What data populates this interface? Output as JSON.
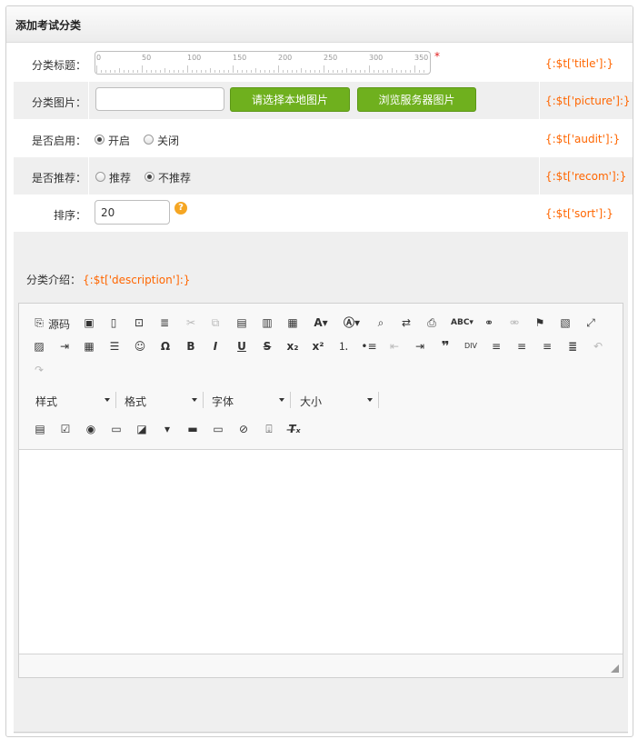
{
  "panel": {
    "title": "添加考试分类"
  },
  "form": {
    "title_row": {
      "label": "分类标题：",
      "ruler_marks": [
        "0",
        "50",
        "100",
        "150",
        "200",
        "250",
        "300",
        "350"
      ],
      "required_mark": "*",
      "hint": "{:$t['title']:}"
    },
    "picture_row": {
      "label": "分类图片：",
      "input_value": "",
      "local_button": "请选择本地图片",
      "server_button": "浏览服务器图片",
      "hint": "{:$t['picture']:}"
    },
    "audit_row": {
      "label": "是否启用：",
      "options": [
        "开启",
        "关闭"
      ],
      "selected": "开启",
      "hint": "{:$t['audit']:}"
    },
    "recom_row": {
      "label": "是否推荐：",
      "options": [
        "推荐",
        "不推荐"
      ],
      "selected": "不推荐",
      "hint": "{:$t['recom']:}"
    },
    "sort_row": {
      "label": "排序：",
      "input_value": "20",
      "help_icon": "help-icon",
      "hint": "{:$t['sort']:}"
    },
    "description": {
      "label": "分类介绍：",
      "hint": "{:$t['description']:}",
      "editor": {
        "source_label": "源码",
        "style_select": "样式",
        "format_select": "格式",
        "font_select": "字体",
        "size_select": "大小",
        "content": ""
      }
    }
  },
  "colors": {
    "accent_green": "#6fb01e",
    "hint_orange": "#ff6600",
    "required_red": "#e02020"
  }
}
